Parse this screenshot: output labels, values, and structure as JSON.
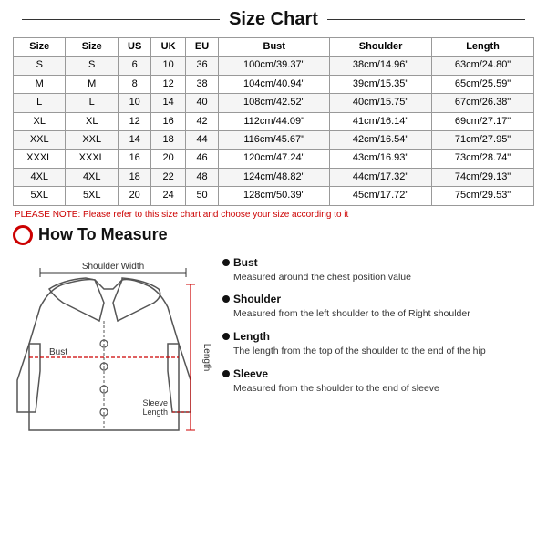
{
  "title": "Size Chart",
  "table": {
    "headers": [
      "Size",
      "Size",
      "US",
      "UK",
      "EU",
      "Bust",
      "Shoulder",
      "Length"
    ],
    "rows": [
      [
        "S",
        "S",
        "6",
        "10",
        "36",
        "100cm/39.37\"",
        "38cm/14.96\"",
        "63cm/24.80\""
      ],
      [
        "M",
        "M",
        "8",
        "12",
        "38",
        "104cm/40.94\"",
        "39cm/15.35\"",
        "65cm/25.59\""
      ],
      [
        "L",
        "L",
        "10",
        "14",
        "40",
        "108cm/42.52\"",
        "40cm/15.75\"",
        "67cm/26.38\""
      ],
      [
        "XL",
        "XL",
        "12",
        "16",
        "42",
        "112cm/44.09\"",
        "41cm/16.14\"",
        "69cm/27.17\""
      ],
      [
        "XXL",
        "XXL",
        "14",
        "18",
        "44",
        "116cm/45.67\"",
        "42cm/16.54\"",
        "71cm/27.95\""
      ],
      [
        "XXXL",
        "XXXL",
        "16",
        "20",
        "46",
        "120cm/47.24\"",
        "43cm/16.93\"",
        "73cm/28.74\""
      ],
      [
        "4XL",
        "4XL",
        "18",
        "22",
        "48",
        "124cm/48.82\"",
        "44cm/17.32\"",
        "74cm/29.13\""
      ],
      [
        "5XL",
        "5XL",
        "20",
        "24",
        "50",
        "128cm/50.39\"",
        "45cm/17.72\"",
        "75cm/29.53\""
      ]
    ]
  },
  "please_note": "PLEASE NOTE: Please refer to this size chart and choose your size according to it",
  "how_to_measure_title": "How To Measure",
  "jacket_labels": {
    "shoulder_width": "Shoulder Width",
    "bust": "Bust",
    "sleeve_length": "Sleeve\nLength",
    "length": "Length"
  },
  "measurements": [
    {
      "title": "Bust",
      "desc": "Measured around the chest position value"
    },
    {
      "title": "Shoulder",
      "desc": "Measured from the left shoulder to the of Right shoulder"
    },
    {
      "title": "Length",
      "desc": "The length from the top of the shoulder to the end of the hip"
    },
    {
      "title": "Sleeve",
      "desc": "Measured from the shoulder to the end of sleeve"
    }
  ]
}
